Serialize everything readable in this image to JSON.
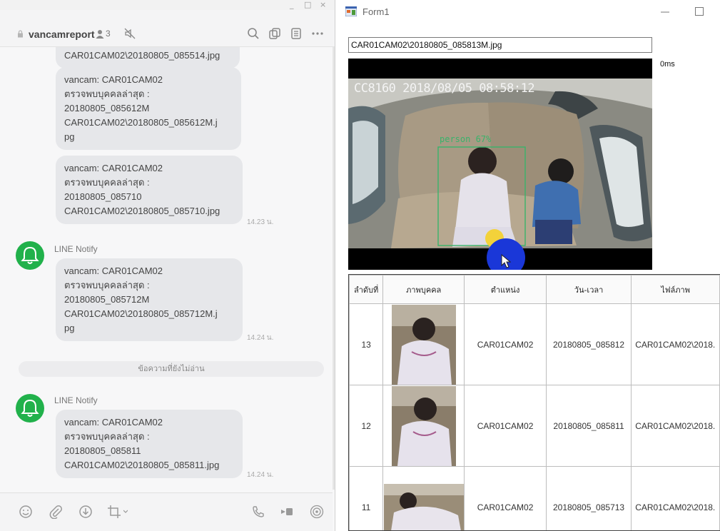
{
  "line": {
    "window_controls": [
      "_",
      "□",
      "×"
    ],
    "chat_name": "vancamreport",
    "member_count": "3",
    "messages": [
      {
        "text": "CAR01CAM02\\20180805_085514.jpg",
        "time": ""
      },
      {
        "text": "vancam: CAR01CAM02\nตรวจพบบุคคลล่าสุด :\n20180805_085612M\nCAR01CAM02\\20180805_085612M.j\npg",
        "time": ""
      },
      {
        "text": "vancam: CAR01CAM02\nตรวจพบบุคคลล่าสุด :\n20180805_085710\nCAR01CAM02\\20180805_085710.jpg",
        "time": "14.23 น."
      },
      {
        "sender": "LINE Notify",
        "text": "vancam: CAR01CAM02\nตรวจพบบุคคลล่าสุด :\n20180805_085712M\nCAR01CAM02\\20180805_085712M.j\npg",
        "time": "14.24 น."
      },
      {
        "sender": "LINE Notify",
        "text": "vancam: CAR01CAM02\nตรวจพบบุคคลล่าสุด :\n20180805_085811\nCAR01CAM02\\20180805_085811.jpg",
        "time": "14.24 น."
      }
    ],
    "unread_divider": "ข้อความที่ยังไม่อ่าน"
  },
  "form": {
    "title": "Form1",
    "path_value": "CAR01CAM02\\20180805_085813M.jpg",
    "elapsed": "0ms",
    "camera": {
      "timestamp": "CC8160 2018/08/05 08:58:12",
      "detection_label": "person 67%"
    },
    "grid": {
      "columns": [
        "ลำดับที่",
        "ภาพบุคคล",
        "ตำแหน่ง",
        "วัน-เวลา",
        "ไฟล์ภาพ"
      ],
      "rows": [
        {
          "index": "13",
          "position": "CAR01CAM02",
          "datetime": "20180805_085812",
          "file": "CAR01CAM02\\2018."
        },
        {
          "index": "12",
          "position": "CAR01CAM02",
          "datetime": "20180805_085811",
          "file": "CAR01CAM02\\2018."
        },
        {
          "index": "11",
          "position": "CAR01CAM02",
          "datetime": "20180805_085713",
          "file": "CAR01CAM02\\2018."
        }
      ]
    }
  },
  "colors": {
    "line_green": "#21b14b",
    "bubble": "#e6e7ea",
    "detection_box": "#38b36a",
    "cursor_highlight": "#1a37d8"
  }
}
